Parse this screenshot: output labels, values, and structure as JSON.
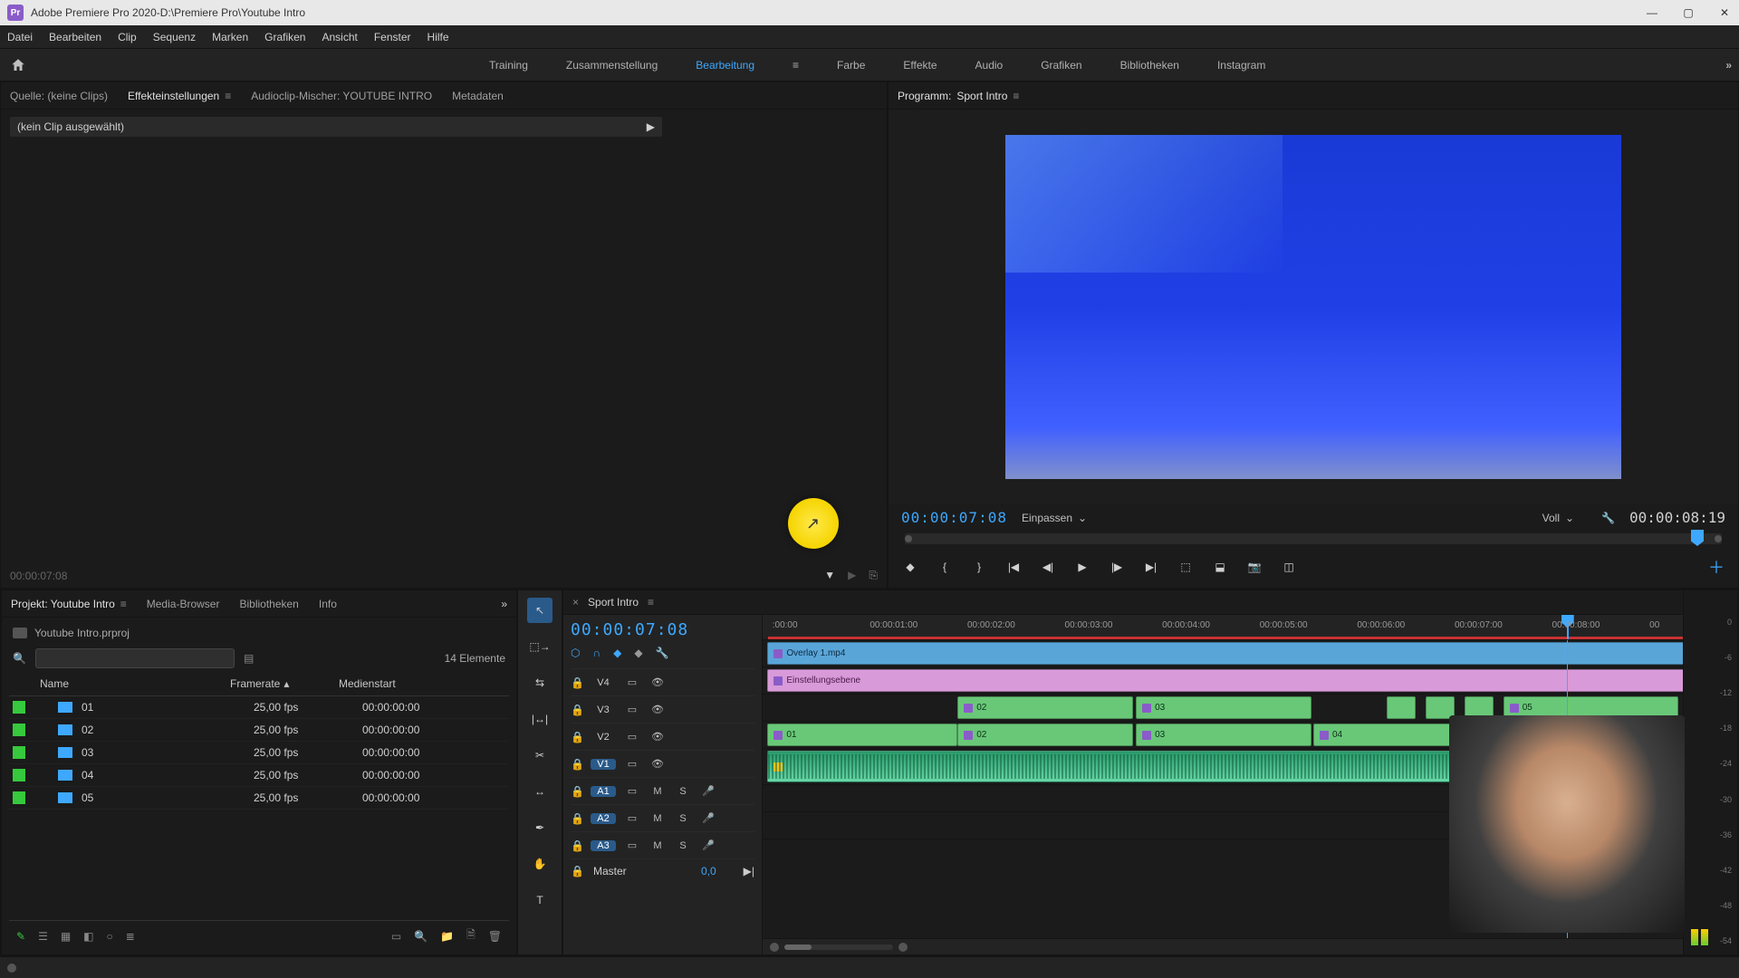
{
  "titlebar": {
    "app": "Adobe Premiere Pro 2020",
    "sep": " - ",
    "path": "D:\\Premiere Pro\\Youtube Intro"
  },
  "menu": [
    "Datei",
    "Bearbeiten",
    "Clip",
    "Sequenz",
    "Marken",
    "Grafiken",
    "Ansicht",
    "Fenster",
    "Hilfe"
  ],
  "workspaces": {
    "items": [
      "Training",
      "Zusammenstellung",
      "Bearbeitung",
      "Farbe",
      "Effekte",
      "Audio",
      "Grafiken",
      "Bibliotheken",
      "Instagram"
    ],
    "active": "Bearbeitung"
  },
  "source_panel": {
    "tabs": {
      "source": "Quelle: (keine Clips)",
      "effect": "Effekteinstellungen",
      "mixer": "Audioclip-Mischer: YOUTUBE INTRO",
      "metadata": "Metadaten"
    },
    "noclip": "(kein Clip ausgewählt)",
    "footer_tc": "00:00:07:08"
  },
  "program": {
    "title_prefix": "Programm: ",
    "sequence": "Sport Intro",
    "timecode": "00:00:07:08",
    "fit": "Einpassen",
    "quality": "Voll",
    "duration": "00:00:08:19"
  },
  "project": {
    "tabs": {
      "project": "Projekt: Youtube Intro",
      "media": "Media-Browser",
      "libs": "Bibliotheken",
      "info": "Info"
    },
    "filename": "Youtube Intro.prproj",
    "count": "14 Elemente",
    "columns": {
      "name": "Name",
      "framerate": "Framerate",
      "mediastart": "Medienstart"
    },
    "rows": [
      {
        "name": "01",
        "fr": "25,00 fps",
        "ms": "00:00:00:00"
      },
      {
        "name": "02",
        "fr": "25,00 fps",
        "ms": "00:00:00:00"
      },
      {
        "name": "03",
        "fr": "25,00 fps",
        "ms": "00:00:00:00"
      },
      {
        "name": "04",
        "fr": "25,00 fps",
        "ms": "00:00:00:00"
      },
      {
        "name": "05",
        "fr": "25,00 fps",
        "ms": "00:00:00:00"
      }
    ]
  },
  "timeline": {
    "sequence": "Sport Intro",
    "timecode": "00:00:07:08",
    "ruler": [
      ":00:00",
      "00:00:01:00",
      "00:00:02:00",
      "00:00:03:00",
      "00:00:04:00",
      "00:00:05:00",
      "00:00:06:00",
      "00:00:07:00",
      "00:00:08:00",
      "00"
    ],
    "tracks": {
      "v4": "V4",
      "v3": "V3",
      "v2": "V2",
      "v1": "V1",
      "a1": "A1",
      "a2": "A2",
      "a3": "A3",
      "master": "Master",
      "master_val": "0,0"
    },
    "toggles": {
      "m": "M",
      "s": "S"
    },
    "clips": {
      "overlay": "Overlay 1.mp4",
      "adjust": "Einstellungsebene",
      "v2": {
        "c02": "02",
        "c03": "03",
        "c05": "05"
      },
      "v1": {
        "c01": "01",
        "c02": "02",
        "c03": "03",
        "c04": "04"
      }
    }
  },
  "meters": {
    "marks": [
      "0",
      "-6",
      "-12",
      "-18",
      "-24",
      "-30",
      "-36",
      "-42",
      "-48",
      "-54"
    ]
  }
}
